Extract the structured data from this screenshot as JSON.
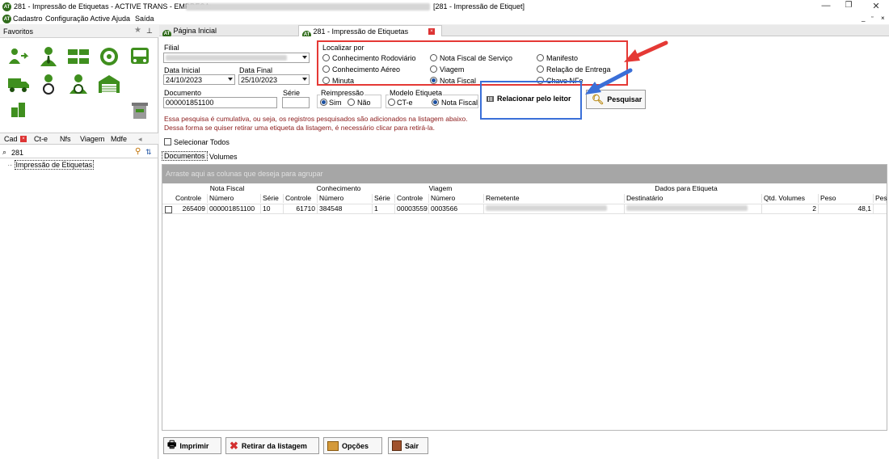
{
  "window": {
    "title_prefix": "281 - Impressão de Etiquetas - ACTIVE TRANS - EMPRESA:",
    "title_suffix": "[281 - Impressão de Etiquet]",
    "logo_text": "AT"
  },
  "menu": {
    "items": [
      "Cadastro",
      "Configuração Active",
      "Ajuda",
      "Saída"
    ]
  },
  "left_panel": {
    "favorites_label": "Favoritos",
    "bottom_tabs": [
      "Cad",
      "Ct-e",
      "Nfs",
      "Viagem",
      "Mdfe"
    ],
    "search_value": "281",
    "tree_item": "Impressão de Etiquetas"
  },
  "doc_tabs": [
    {
      "label": "Página Inicial"
    },
    {
      "label": "281 - Impressão de Etiquetas"
    }
  ],
  "form": {
    "filial_label": "Filial",
    "data_inicial_label": "Data Inicial",
    "data_inicial_value": "24/10/2023",
    "data_final_label": "Data Final",
    "data_final_value": "25/10/2023",
    "documento_label": "Documento",
    "documento_value": "000001851100",
    "serie_label": "Série",
    "localizar_por": {
      "title": "Localizar por",
      "options": [
        {
          "label": "Conhecimento Rodoviário",
          "selected": false
        },
        {
          "label": "Nota Fiscal de Serviço",
          "selected": false
        },
        {
          "label": "Manifesto",
          "selected": false
        },
        {
          "label": "Conhecimento Aéreo",
          "selected": false
        },
        {
          "label": "Viagem",
          "selected": false
        },
        {
          "label": "Relação de Entrega",
          "selected": false
        },
        {
          "label": "Minuta",
          "selected": false
        },
        {
          "label": "Nota Fiscal",
          "selected": true
        },
        {
          "label": "Chave NFe",
          "selected": false
        }
      ]
    },
    "reimpressao": {
      "title": "Reimpressão",
      "sim": "Sim",
      "nao": "Não",
      "selected": "Sim"
    },
    "modelo_etiqueta": {
      "title": "Modelo Etiqueta",
      "cte": "CT-e",
      "nf": "Nota Fiscal",
      "selected": "Nota Fiscal"
    },
    "relacionar_button": "Relacionar pelo leitor",
    "pesquisar_button": "Pesquisar",
    "message_line1": "Essa pesquisa é cumulativa, ou seja, os registros pesquisados são adicionados na listagem abaixo.",
    "message_line2": "Dessa forma se quiser retirar uma etiqueta da listagem, é necessário clicar para retirá-la.",
    "selecionar_todos": "Selecionar Todos"
  },
  "grid_tabs": [
    "Documentos",
    "Volumes"
  ],
  "grid": {
    "group_bar_text": "Arraste aqui as colunas que deseja para agrupar",
    "column_groups": [
      "Nota Fiscal",
      "Conhecimento",
      "Viagem",
      "Dados para Etiqueta"
    ],
    "columns": [
      "Controle",
      "Número",
      "Série",
      "Controle",
      "Número",
      "Série",
      "Controle",
      "Número",
      "Remetente",
      "Destinatário",
      "Qtd. Volumes",
      "Peso",
      "Pes"
    ],
    "rows": [
      {
        "nf_controle": "265409",
        "nf_numero": "000001851100",
        "nf_serie": "10",
        "ct_controle": "61710",
        "ct_numero": "384548",
        "ct_serie": "1",
        "vg_controle": "00003559",
        "vg_numero": "0003566",
        "qtd_volumes": "2",
        "peso": "48,1"
      }
    ]
  },
  "bottom_buttons": [
    "Imprimir",
    "Retirar da listagem",
    "Opções",
    "Sair"
  ],
  "annotation_colors": {
    "red": "#e53935",
    "blue": "#3a6fd8"
  }
}
